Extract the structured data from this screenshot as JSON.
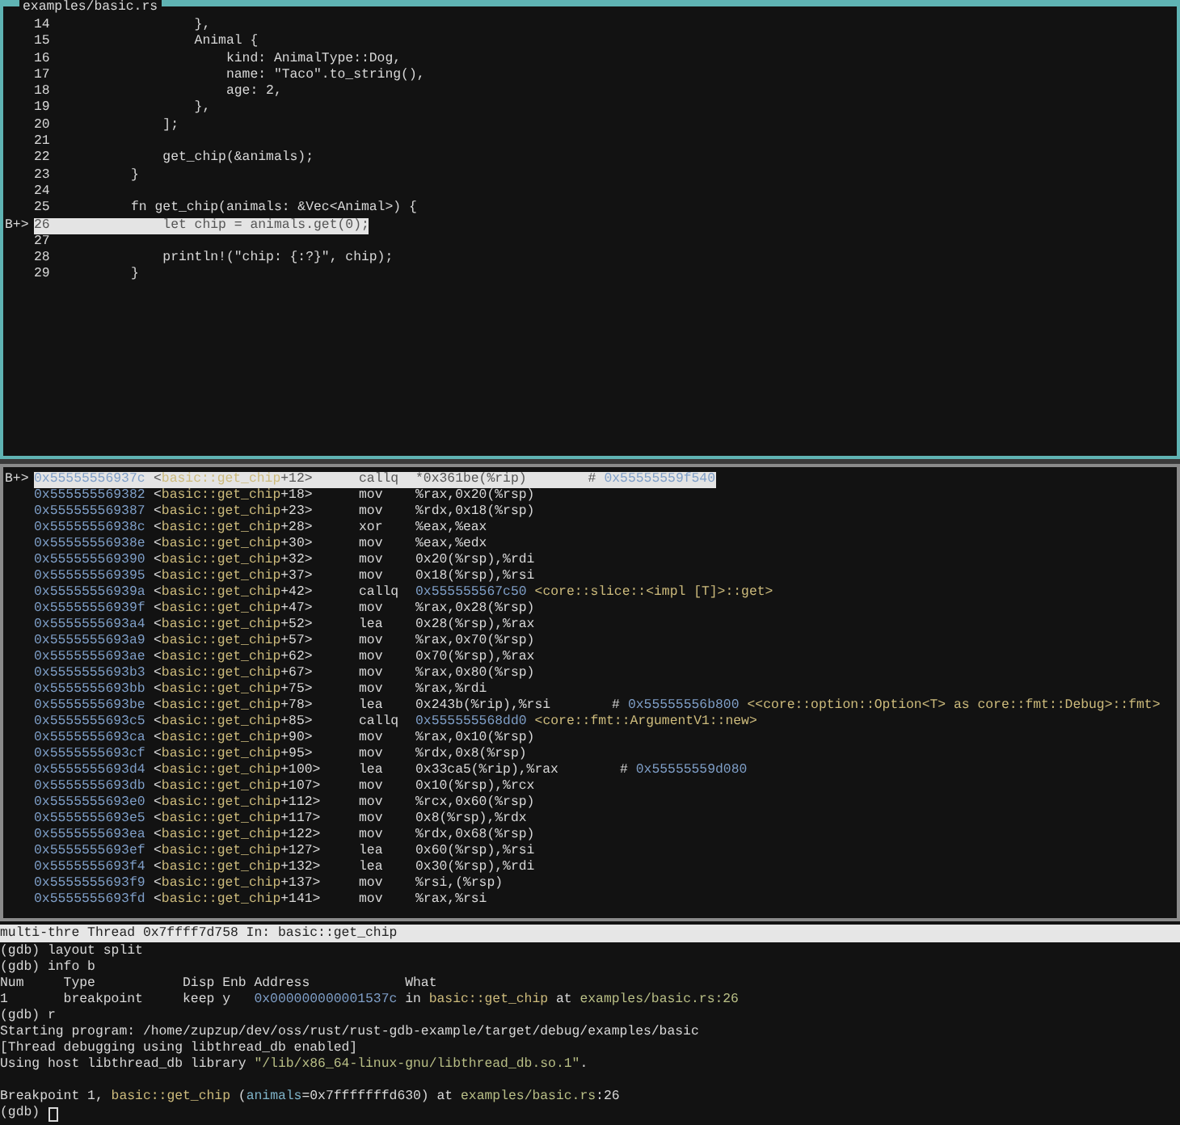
{
  "source_pane": {
    "title": "examples/basic.rs",
    "lines": [
      {
        "number": "14",
        "code": "        },",
        "selected": false
      },
      {
        "number": "15",
        "code": "        Animal {",
        "selected": false
      },
      {
        "number": "16",
        "code": "            kind: AnimalType::Dog,",
        "selected": false
      },
      {
        "number": "17",
        "code": "            name: \"Taco\".to_string(),",
        "selected": false
      },
      {
        "number": "18",
        "code": "            age: 2,",
        "selected": false
      },
      {
        "number": "19",
        "code": "        },",
        "selected": false
      },
      {
        "number": "20",
        "code": "    ];",
        "selected": false
      },
      {
        "number": "21",
        "selected": false
      },
      {
        "number": "22",
        "code": "    get_chip(&animals);",
        "selected": false
      },
      {
        "number": "23",
        "code": "}",
        "selected": false
      },
      {
        "number": "24",
        "selected": false
      },
      {
        "number": "25",
        "code": "fn get_chip(animals: &Vec<Animal>) {",
        "selected": false
      },
      {
        "number": "26",
        "code": "    let chip = animals.get(0);",
        "marker": "B+>",
        "selected": true
      },
      {
        "number": "27",
        "selected": false
      },
      {
        "number": "28",
        "code": "    println!(\"chip: {:?}\", chip);",
        "selected": false
      },
      {
        "number": "29",
        "code": "}",
        "selected": false
      }
    ]
  },
  "disassembly_pane": {
    "lines": [
      {
        "marker": "B+>",
        "address": "0x55555556937c",
        "symbol": [
          "<",
          "basic::get_chip",
          "+12>"
        ],
        "mnemonic": "callq",
        "operands": "*0x361be(%rip)",
        "comment": [
          "#",
          "0x55555559f540"
        ],
        "selected": true
      },
      {
        "address": "0x555555569382",
        "symbol": [
          "<",
          "basic::get_chip",
          "+18>"
        ],
        "mnemonic": "mov",
        "operands": "%rax,0x20(%rsp)",
        "selected": false
      },
      {
        "address": "0x555555569387",
        "symbol": [
          "<",
          "basic::get_chip",
          "+23>"
        ],
        "mnemonic": "mov",
        "operands": "%rdx,0x18(%rsp)",
        "selected": false
      },
      {
        "address": "0x55555556938c",
        "symbol": [
          "<",
          "basic::get_chip",
          "+28>"
        ],
        "mnemonic": "xor",
        "operands": "%eax,%eax",
        "selected": false
      },
      {
        "address": "0x55555556938e",
        "symbol": [
          "<",
          "basic::get_chip",
          "+30>"
        ],
        "mnemonic": "mov",
        "operands": "%eax,%edx",
        "selected": false
      },
      {
        "address": "0x555555569390",
        "symbol": [
          "<",
          "basic::get_chip",
          "+32>"
        ],
        "mnemonic": "mov",
        "operands": "0x20(%rsp),%rdi",
        "selected": false
      },
      {
        "address": "0x555555569395",
        "symbol": [
          "<",
          "basic::get_chip",
          "+37>"
        ],
        "mnemonic": "mov",
        "operands": "0x18(%rsp),%rsi",
        "selected": false
      },
      {
        "address": "0x55555556939a",
        "symbol": [
          "<",
          "basic::get_chip",
          "+42>"
        ],
        "mnemonic": "callq",
        "operands": "0x555555567c50",
        "target": "<core::slice::<impl [T]>::get>",
        "selected": false
      },
      {
        "address": "0x55555556939f",
        "symbol": [
          "<",
          "basic::get_chip",
          "+47>"
        ],
        "mnemonic": "mov",
        "operands": "%rax,0x28(%rsp)",
        "selected": false
      },
      {
        "address": "0x5555555693a4",
        "symbol": [
          "<",
          "basic::get_chip",
          "+52>"
        ],
        "mnemonic": "lea",
        "operands": "0x28(%rsp),%rax",
        "selected": false
      },
      {
        "address": "0x5555555693a9",
        "symbol": [
          "<",
          "basic::get_chip",
          "+57>"
        ],
        "mnemonic": "mov",
        "operands": "%rax,0x70(%rsp)",
        "selected": false
      },
      {
        "address": "0x5555555693ae",
        "symbol": [
          "<",
          "basic::get_chip",
          "+62>"
        ],
        "mnemonic": "mov",
        "operands": "0x70(%rsp),%rax",
        "selected": false
      },
      {
        "address": "0x5555555693b3",
        "symbol": [
          "<",
          "basic::get_chip",
          "+67>"
        ],
        "mnemonic": "mov",
        "operands": "%rax,0x80(%rsp)",
        "selected": false
      },
      {
        "address": "0x5555555693bb",
        "symbol": [
          "<",
          "basic::get_chip",
          "+75>"
        ],
        "mnemonic": "mov",
        "operands": "%rax,%rdi",
        "selected": false
      },
      {
        "address": "0x5555555693be",
        "symbol": [
          "<",
          "basic::get_chip",
          "+78>"
        ],
        "mnemonic": "lea",
        "operands": "0x243b(%rip),%rsi",
        "comment": [
          "#",
          "0x55555556b800",
          "<<core::option::Option<T> as core::fmt::Debug>::fmt>"
        ],
        "selected": false
      },
      {
        "address": "0x5555555693c5",
        "symbol": [
          "<",
          "basic::get_chip",
          "+85>"
        ],
        "mnemonic": "callq",
        "operands": "0x555555568dd0",
        "target": "<core::fmt::ArgumentV1::new>",
        "selected": false
      },
      {
        "address": "0x5555555693ca",
        "symbol": [
          "<",
          "basic::get_chip",
          "+90>"
        ],
        "mnemonic": "mov",
        "operands": "%rax,0x10(%rsp)",
        "selected": false
      },
      {
        "address": "0x5555555693cf",
        "symbol": [
          "<",
          "basic::get_chip",
          "+95>"
        ],
        "mnemonic": "mov",
        "operands": "%rdx,0x8(%rsp)",
        "selected": false
      },
      {
        "address": "0x5555555693d4",
        "symbol": [
          "<",
          "basic::get_chip",
          "+100>"
        ],
        "mnemonic": "lea",
        "operands": "0x33ca5(%rip),%rax",
        "comment": [
          "#",
          "0x55555559d080"
        ],
        "selected": false
      },
      {
        "address": "0x5555555693db",
        "symbol": [
          "<",
          "basic::get_chip",
          "+107>"
        ],
        "mnemonic": "mov",
        "operands": "0x10(%rsp),%rcx",
        "selected": false
      },
      {
        "address": "0x5555555693e0",
        "symbol": [
          "<",
          "basic::get_chip",
          "+112>"
        ],
        "mnemonic": "mov",
        "operands": "%rcx,0x60(%rsp)",
        "selected": false
      },
      {
        "address": "0x5555555693e5",
        "symbol": [
          "<",
          "basic::get_chip",
          "+117>"
        ],
        "mnemonic": "mov",
        "operands": "0x8(%rsp),%rdx",
        "selected": false
      },
      {
        "address": "0x5555555693ea",
        "symbol": [
          "<",
          "basic::get_chip",
          "+122>"
        ],
        "mnemonic": "mov",
        "operands": "%rdx,0x68(%rsp)",
        "selected": false
      },
      {
        "address": "0x5555555693ef",
        "symbol": [
          "<",
          "basic::get_chip",
          "+127>"
        ],
        "mnemonic": "lea",
        "operands": "0x60(%rsp),%rsi",
        "selected": false
      },
      {
        "address": "0x5555555693f4",
        "symbol": [
          "<",
          "basic::get_chip",
          "+132>"
        ],
        "mnemonic": "lea",
        "operands": "0x30(%rsp),%rdi",
        "selected": false
      },
      {
        "address": "0x5555555693f9",
        "symbol": [
          "<",
          "basic::get_chip",
          "+137>"
        ],
        "mnemonic": "mov",
        "operands": "%rsi,(%rsp)",
        "selected": false
      },
      {
        "address": "0x5555555693fd",
        "symbol": [
          "<",
          "basic::get_chip",
          "+141>"
        ],
        "mnemonic": "mov",
        "operands": "%rax,%rsi",
        "selected": false
      }
    ]
  },
  "status_bar": {
    "text": "multi-thre Thread 0x7ffff7d758 In: basic::get_chip"
  },
  "console": {
    "lines": [
      {
        "kind": "text",
        "segments": [
          {
            "kind": "plain",
            "text": "(gdb) layout split"
          }
        ]
      },
      {
        "kind": "text",
        "segments": [
          {
            "kind": "plain",
            "text": "(gdb) info b"
          }
        ]
      },
      {
        "kind": "text",
        "segments": [
          {
            "kind": "plain",
            "text": "Num     Type           Disp Enb Address            What"
          }
        ]
      },
      {
        "kind": "text",
        "segments": [
          {
            "kind": "plain",
            "text": "1       breakpoint     keep y   "
          },
          {
            "kind": "address",
            "text": "0x000000000001537c"
          },
          {
            "kind": "plain",
            "text": " in "
          },
          {
            "kind": "function",
            "text": "basic::get_chip"
          },
          {
            "kind": "plain",
            "text": " at "
          },
          {
            "kind": "file",
            "text": "examples/basic.rs:26"
          }
        ]
      },
      {
        "kind": "text",
        "segments": [
          {
            "kind": "plain",
            "text": "(gdb) r"
          }
        ]
      },
      {
        "kind": "text",
        "segments": [
          {
            "kind": "plain",
            "text": "Starting program: /home/zupzup/dev/oss/rust/rust-gdb-example/target/debug/examples/basic"
          }
        ]
      },
      {
        "kind": "text",
        "segments": [
          {
            "kind": "plain",
            "text": "[Thread debugging using libthread_db enabled]"
          }
        ]
      },
      {
        "kind": "text",
        "segments": [
          {
            "kind": "plain",
            "text": "Using host libthread_db library "
          },
          {
            "kind": "string",
            "text": "\"/lib/x86_64-linux-gnu/libthread_db.so.1\""
          },
          {
            "kind": "plain",
            "text": "."
          }
        ]
      },
      {
        "kind": "blank"
      },
      {
        "kind": "text",
        "segments": [
          {
            "kind": "plain",
            "text": "Breakpoint 1, "
          },
          {
            "kind": "function",
            "text": "basic::get_chip"
          },
          {
            "kind": "plain",
            "text": " ("
          },
          {
            "kind": "variable",
            "text": "animals"
          },
          {
            "kind": "plain",
            "text": "=0x7fffffffd630) at "
          },
          {
            "kind": "file",
            "text": "examples/basic.rs"
          },
          {
            "kind": "plain",
            "text": ":26"
          }
        ]
      },
      {
        "kind": "prompt",
        "segments": [
          {
            "kind": "plain",
            "text": "(gdb)"
          }
        ],
        "cursor": true
      }
    ]
  }
}
